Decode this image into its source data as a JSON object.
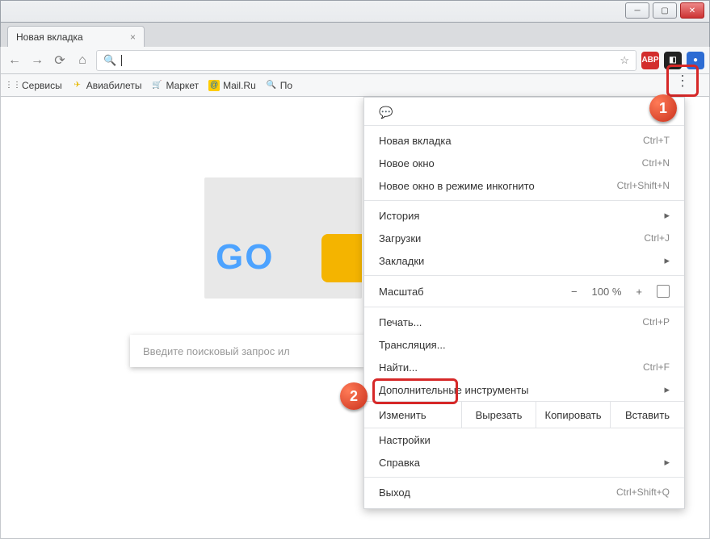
{
  "tab": {
    "title": "Новая вкладка"
  },
  "toolbar": {
    "ext_abp": "ABP"
  },
  "bookmarks": {
    "apps": "Сервисы",
    "avia": "Авиабилеты",
    "market": "Маркет",
    "mail": "Mail.Ru",
    "po": "По"
  },
  "page": {
    "doodle_text": "GO",
    "search_placeholder": "Введите поисковый запрос ил"
  },
  "menu": {
    "new_tab": "Новая вкладка",
    "new_tab_sc": "Ctrl+T",
    "new_win": "Новое окно",
    "new_win_sc": "Ctrl+N",
    "incognito": "Новое окно в режиме инкогнито",
    "incognito_sc": "Ctrl+Shift+N",
    "history": "История",
    "downloads": "Загрузки",
    "downloads_sc": "Ctrl+J",
    "bookmarks": "Закладки",
    "zoom_label": "Масштаб",
    "zoom_minus": "−",
    "zoom_value": "100 %",
    "zoom_plus": "+",
    "print": "Печать...",
    "print_sc": "Ctrl+P",
    "cast": "Трансляция...",
    "find": "Найти...",
    "find_sc": "Ctrl+F",
    "more_tools": "Дополнительные инструменты",
    "edit_label": "Изменить",
    "cut": "Вырезать",
    "copy": "Копировать",
    "paste": "Вставить",
    "settings": "Настройки",
    "help": "Справка",
    "exit": "Выход",
    "exit_sc": "Ctrl+Shift+Q"
  },
  "callout": {
    "one": "1",
    "two": "2"
  }
}
